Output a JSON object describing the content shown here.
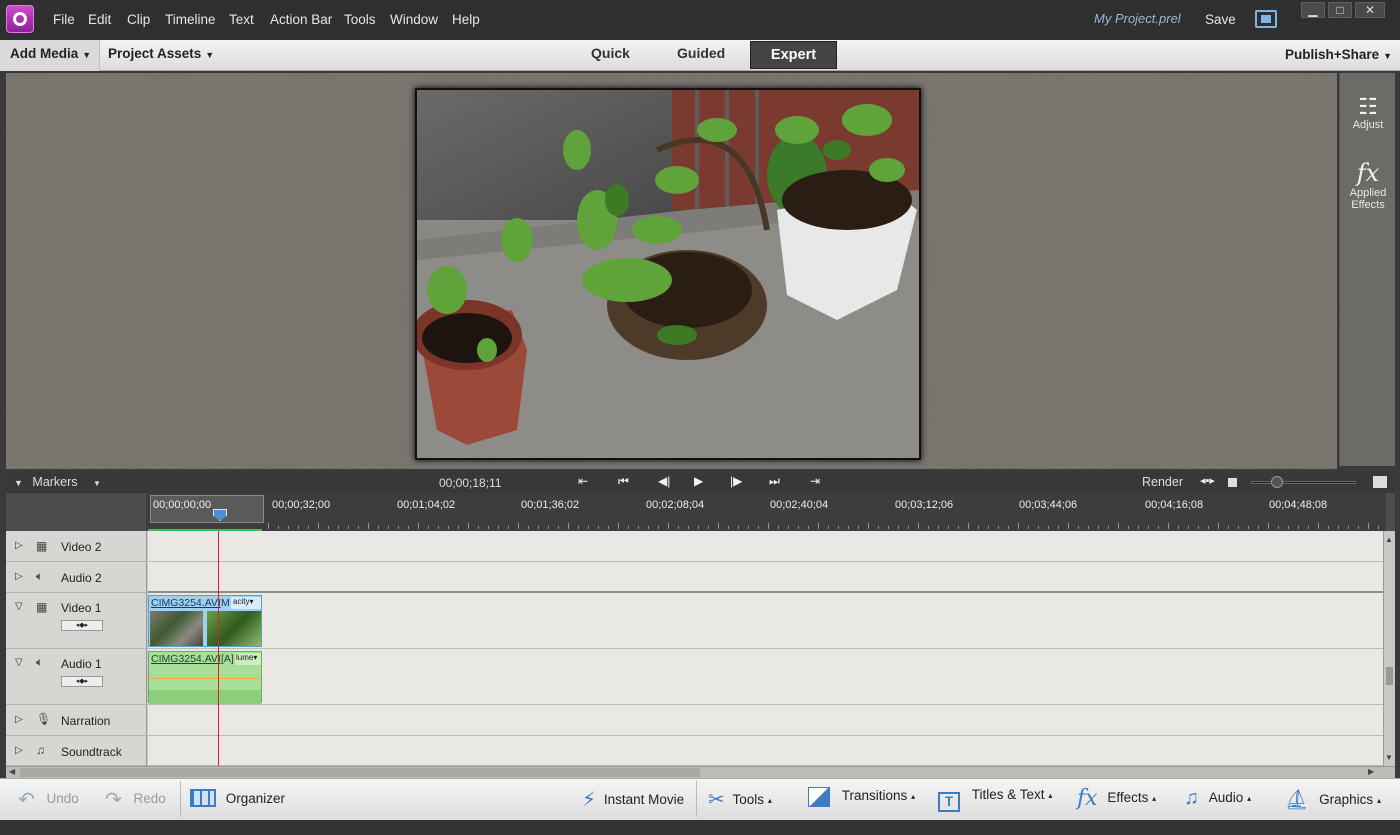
{
  "titlebar": {
    "menu": [
      "File",
      "Edit",
      "Clip",
      "Timeline",
      "Text",
      "Action Bar",
      "Tools",
      "Window",
      "Help"
    ],
    "project_name": "My Project.prel",
    "save": "Save"
  },
  "modebar": {
    "add_media": "Add Media",
    "project_assets": "Project Assets",
    "modes": [
      "Quick",
      "Guided",
      "Expert"
    ],
    "active_mode": "Expert",
    "publish": "Publish+Share"
  },
  "right_panel": {
    "adjust": "Adjust",
    "applied_effects_line1": "Applied",
    "applied_effects_line2": "Effects"
  },
  "timeline_bar": {
    "markers": "Markers",
    "timecode": "00;00;18;11",
    "render": "Render"
  },
  "ruler": {
    "labels": [
      "00;00;00;00",
      "00;00;32;00",
      "00;01;04;02",
      "00;01;36;02",
      "00;02;08;04",
      "00;02;40;04",
      "00;03;12;06",
      "00;03;44;06",
      "00;04;16;08",
      "00;04;48;08"
    ]
  },
  "tracks": [
    {
      "name": "Video 2",
      "icon": "film-icon"
    },
    {
      "name": "Audio 2",
      "icon": "speaker-icon"
    },
    {
      "name": "Video 1",
      "icon": "film-icon"
    },
    {
      "name": "Audio 1",
      "icon": "speaker-icon"
    },
    {
      "name": "Narration",
      "icon": "microphone-icon"
    },
    {
      "name": "Soundtrack",
      "icon": "music-icon"
    }
  ],
  "clips": {
    "video_clip_label": "CIMG3254.AVI",
    "video_clip_tag": "M",
    "video_clip_effect": "acity",
    "audio_clip_label": "CIMG3254.AVI",
    "audio_clip_tag": "[A]",
    "audio_clip_effect": "lume"
  },
  "actionbar": {
    "undo": "Undo",
    "redo": "Redo",
    "organizer": "Organizer",
    "instant_movie": "Instant Movie",
    "tools": "Tools",
    "transitions": "Transitions",
    "titles_text": "Titles & Text",
    "effects": "Effects",
    "audio": "Audio",
    "graphics": "Graphics"
  }
}
